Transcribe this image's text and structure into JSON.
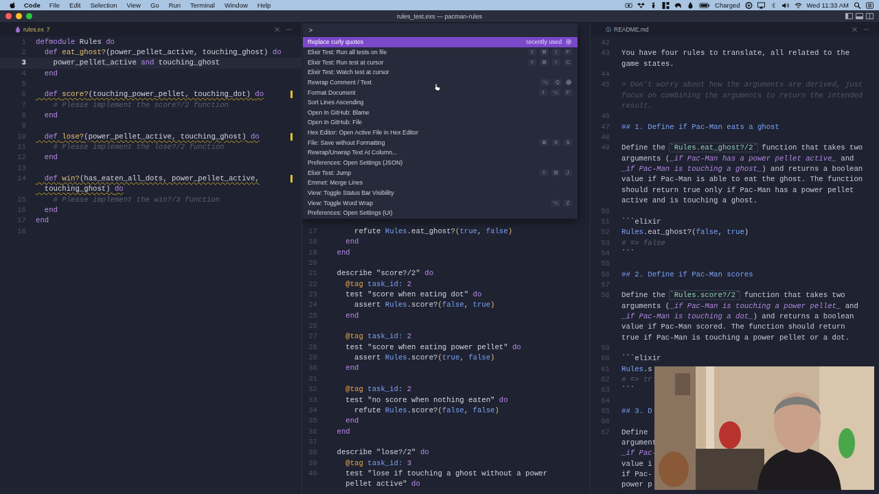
{
  "menu_bar": {
    "app": "Code",
    "menus": [
      "File",
      "Edit",
      "Selection",
      "View",
      "Go",
      "Run",
      "Terminal",
      "Window",
      "Help"
    ],
    "battery": "Charged",
    "clock": "Wed 11:33 AM"
  },
  "window": {
    "title": "rules_test.exs — pacman-rules"
  },
  "left": {
    "tab": {
      "title": "rules.ex",
      "problems": "7"
    },
    "lines": [
      {
        "num": "1",
        "current": false,
        "warning": false,
        "spans": [
          {
            "text": "defmodule",
            "kind": "kw"
          },
          {
            "text": " Rules ",
            "kind": "plain"
          },
          {
            "text": "do",
            "kind": "kw"
          }
        ]
      },
      {
        "num": "2",
        "current": false,
        "warning": false,
        "spans": [
          {
            "text": "  def ",
            "kind": "kw"
          },
          {
            "text": "eat_ghost?",
            "kind": "fn"
          },
          {
            "text": "(power_pellet_active, touching_ghost) ",
            "kind": "plain"
          },
          {
            "text": "do",
            "kind": "kw"
          }
        ]
      },
      {
        "num": "3",
        "current": true,
        "warning": false,
        "spans": [
          {
            "text": "    power_pellet_active ",
            "kind": "plain"
          },
          {
            "text": "and",
            "kind": "kw"
          },
          {
            "text": " touching_ghost",
            "kind": "plain"
          }
        ]
      },
      {
        "num": "4",
        "current": false,
        "warning": false,
        "spans": [
          {
            "text": "  end",
            "kind": "kw"
          }
        ]
      },
      {
        "num": "5",
        "current": false,
        "warning": false
      },
      {
        "num": "6",
        "current": false,
        "warning": true,
        "spans": [
          {
            "text": "  def ",
            "kind": "kw"
          },
          {
            "text": "score?",
            "kind": "fn"
          },
          {
            "text": "(touching_power_pellet, touching_dot) ",
            "kind": "plain"
          },
          {
            "text": "do",
            "kind": "kw"
          }
        ]
      },
      {
        "num": "7",
        "current": false,
        "warning": false,
        "spans": [
          {
            "text": "    # Please implement the score?/2 function",
            "kind": "comment"
          }
        ]
      },
      {
        "num": "8",
        "current": false,
        "warning": false,
        "spans": [
          {
            "text": "  end",
            "kind": "kw"
          }
        ]
      },
      {
        "num": "9",
        "current": false,
        "warning": false
      },
      {
        "num": "10",
        "current": false,
        "warning": true,
        "spans": [
          {
            "text": "  def ",
            "kind": "kw"
          },
          {
            "text": "lose?",
            "kind": "fn"
          },
          {
            "text": "(power_pellet_active, touching_ghost) ",
            "kind": "plain"
          },
          {
            "text": "do",
            "kind": "kw"
          }
        ]
      },
      {
        "num": "11",
        "current": false,
        "warning": false,
        "spans": [
          {
            "text": "    # Please implement the lose?/2 function",
            "kind": "comment"
          }
        ]
      },
      {
        "num": "12",
        "current": false,
        "warning": false,
        "spans": [
          {
            "text": "  end",
            "kind": "kw"
          }
        ]
      },
      {
        "num": "13",
        "current": false,
        "warning": false
      },
      {
        "num": "14",
        "current": false,
        "warning": true,
        "spans": [
          {
            "text": "  def ",
            "kind": "kw"
          },
          {
            "text": "win?",
            "kind": "fn"
          },
          {
            "text": "(has_eaten_all_dots, power_pellet_active,",
            "kind": "plain"
          }
        ]
      },
      {
        "current": false,
        "warning": true,
        "spans": [
          {
            "text": "  touching_ghost) ",
            "kind": "plain"
          },
          {
            "text": "do",
            "kind": "kw"
          }
        ]
      },
      {
        "num": "15",
        "current": false,
        "warning": false,
        "spans": [
          {
            "text": "    # Please implement the win?/3 function",
            "kind": "comment"
          }
        ]
      },
      {
        "num": "16",
        "current": false,
        "warning": false,
        "spans": [
          {
            "text": "  end",
            "kind": "kw"
          }
        ]
      },
      {
        "num": "17",
        "current": false,
        "warning": false,
        "spans": [
          {
            "text": "end",
            "kind": "kw"
          }
        ]
      },
      {
        "num": "18",
        "current": false,
        "warning": false
      }
    ]
  },
  "palette": {
    "input": ">",
    "items": [
      {
        "label": "Replace curly quotes",
        "selected": true,
        "hovered": false,
        "note": "recently used"
      },
      {
        "label": "Elixir Test: Run all tests on file",
        "selected": false,
        "hovered": false,
        "keys": [
          "⇧",
          "⌘",
          "I",
          "F"
        ]
      },
      {
        "label": "Elixir Test: Run test at cursor",
        "selected": false,
        "hovered": false,
        "keys": [
          "⇧",
          "⌘",
          "I",
          "C"
        ]
      },
      {
        "label": "Elixir Test: Watch test at cursor",
        "selected": false,
        "hovered": false
      },
      {
        "label": "Rewrap Comment / Text",
        "selected": false,
        "hovered": true,
        "keys": [
          "⌥",
          "Q"
        ]
      },
      {
        "label": "Format Document",
        "selected": false,
        "hovered": false,
        "keys": [
          "⇧",
          "⌥",
          "F"
        ]
      },
      {
        "label": "Sort Lines Ascending",
        "selected": false,
        "hovered": false
      },
      {
        "label": "Open In GitHub: Blame",
        "selected": false,
        "hovered": false
      },
      {
        "label": "Open In GitHub: File",
        "selected": false,
        "hovered": false
      },
      {
        "label": "Hex Editor: Open Active File in Hex Editor",
        "selected": false,
        "hovered": false
      },
      {
        "label": "File: Save without Formatting",
        "selected": false,
        "hovered": false,
        "keys": [
          "⌘",
          "K",
          "S"
        ]
      },
      {
        "label": "Rewrap/Unwrap Text At Column...",
        "selected": false,
        "hovered": false
      },
      {
        "label": "Preferences: Open Settings (JSON)",
        "selected": false,
        "hovered": false
      },
      {
        "label": "Elixir Test: Jump",
        "selected": false,
        "hovered": false,
        "keys": [
          "⇧",
          "⌘",
          "J"
        ]
      },
      {
        "label": "Emmet: Merge Lines",
        "selected": false,
        "hovered": false
      },
      {
        "label": "View: Toggle Status Bar Visibility",
        "selected": false,
        "hovered": false
      },
      {
        "label": "View: Toggle Word Wrap",
        "selected": false,
        "hovered": false,
        "keys": [
          "⌥",
          "Z"
        ]
      },
      {
        "label": "Preferences: Open Settings (UI)",
        "selected": false,
        "hovered": false
      }
    ]
  },
  "middle": {
    "lines": [
      {
        "num": "17",
        "spans": [
          {
            "text": "        refute ",
            "kind": "plain"
          },
          {
            "text": "Rules",
            "kind": "mod"
          },
          {
            "text": ".eat_ghost?",
            "kind": "plain"
          },
          {
            "text": "(",
            "kind": "paren"
          },
          {
            "text": "true",
            "kind": "bool"
          },
          {
            "text": ", ",
            "kind": "plain"
          },
          {
            "text": "false",
            "kind": "bool"
          },
          {
            "text": ")",
            "kind": "paren"
          }
        ]
      },
      {
        "num": "18",
        "spans": [
          {
            "text": "      end",
            "kind": "kw"
          }
        ]
      },
      {
        "num": "19",
        "spans": [
          {
            "text": "    end",
            "kind": "kw"
          }
        ]
      },
      {
        "num": "20"
      },
      {
        "num": "21",
        "spans": [
          {
            "text": "    describe \"score?/2\" ",
            "kind": "plain"
          },
          {
            "text": "do",
            "kind": "kw"
          }
        ]
      },
      {
        "num": "22",
        "spans": [
          {
            "text": "      @tag ",
            "kind": "attr"
          },
          {
            "text": "task_id: ",
            "kind": "atom"
          },
          {
            "text": "2",
            "kind": "num"
          }
        ]
      },
      {
        "num": "23",
        "spans": [
          {
            "text": "      test \"score when eating dot\" ",
            "kind": "plain"
          },
          {
            "text": "do",
            "kind": "kw"
          }
        ]
      },
      {
        "num": "24",
        "spans": [
          {
            "text": "        assert ",
            "kind": "plain"
          },
          {
            "text": "Rules",
            "kind": "mod"
          },
          {
            "text": ".score?",
            "kind": "plain"
          },
          {
            "text": "(",
            "kind": "paren"
          },
          {
            "text": "false",
            "kind": "bool"
          },
          {
            "text": ", ",
            "kind": "plain"
          },
          {
            "text": "true",
            "kind": "bool"
          },
          {
            "text": ")",
            "kind": "paren"
          }
        ]
      },
      {
        "num": "25",
        "spans": [
          {
            "text": "      end",
            "kind": "kw"
          }
        ]
      },
      {
        "num": "26"
      },
      {
        "num": "27",
        "spans": [
          {
            "text": "      @tag ",
            "kind": "attr"
          },
          {
            "text": "task_id: ",
            "kind": "atom"
          },
          {
            "text": "2",
            "kind": "num"
          }
        ]
      },
      {
        "num": "28",
        "spans": [
          {
            "text": "      test \"score when eating power pellet\" ",
            "kind": "plain"
          },
          {
            "text": "do",
            "kind": "kw"
          }
        ]
      },
      {
        "num": "29",
        "spans": [
          {
            "text": "        assert ",
            "kind": "plain"
          },
          {
            "text": "Rules",
            "kind": "mod"
          },
          {
            "text": ".score?",
            "kind": "plain"
          },
          {
            "text": "(",
            "kind": "paren"
          },
          {
            "text": "true",
            "kind": "bool"
          },
          {
            "text": ", ",
            "kind": "plain"
          },
          {
            "text": "false",
            "kind": "bool"
          },
          {
            "text": ")",
            "kind": "paren"
          }
        ]
      },
      {
        "num": "30",
        "spans": [
          {
            "text": "      end",
            "kind": "kw"
          }
        ]
      },
      {
        "num": "31"
      },
      {
        "num": "32",
        "spans": [
          {
            "text": "      @tag ",
            "kind": "attr"
          },
          {
            "text": "task_id: ",
            "kind": "atom"
          },
          {
            "text": "2",
            "kind": "num"
          }
        ]
      },
      {
        "num": "33",
        "spans": [
          {
            "text": "      test \"no score when nothing eaten\" ",
            "kind": "plain"
          },
          {
            "text": "do",
            "kind": "kw"
          }
        ]
      },
      {
        "num": "34",
        "spans": [
          {
            "text": "        refute ",
            "kind": "plain"
          },
          {
            "text": "Rules",
            "kind": "mod"
          },
          {
            "text": ".score?",
            "kind": "plain"
          },
          {
            "text": "(",
            "kind": "paren"
          },
          {
            "text": "false",
            "kind": "bool"
          },
          {
            "text": ", ",
            "kind": "plain"
          },
          {
            "text": "false",
            "kind": "bool"
          },
          {
            "text": ")",
            "kind": "paren"
          }
        ]
      },
      {
        "num": "35",
        "spans": [
          {
            "text": "      end",
            "kind": "kw"
          }
        ]
      },
      {
        "num": "36",
        "spans": [
          {
            "text": "    end",
            "kind": "kw"
          }
        ]
      },
      {
        "num": "37"
      },
      {
        "num": "38",
        "spans": [
          {
            "text": "    describe \"lose?/2\" ",
            "kind": "plain"
          },
          {
            "text": "do",
            "kind": "kw"
          }
        ]
      },
      {
        "num": "39",
        "spans": [
          {
            "text": "      @tag ",
            "kind": "attr"
          },
          {
            "text": "task_id: ",
            "kind": "atom"
          },
          {
            "text": "3",
            "kind": "num"
          }
        ]
      },
      {
        "num": "40",
        "spans": [
          {
            "text": "      test \"lose if touching a ghost without a power",
            "kind": "plain"
          }
        ]
      },
      {
        "spans": [
          {
            "text": "      pellet active\" ",
            "kind": "plain"
          },
          {
            "text": "do",
            "kind": "kw"
          }
        ]
      }
    ]
  },
  "right": {
    "tab": {
      "title": "README.md"
    },
    "lines": [
      {
        "num": "42"
      },
      {
        "num": "43",
        "spans": [
          {
            "text": "You have four rules to translate, all related to the",
            "kind": "text"
          }
        ]
      },
      {
        "spans": [
          {
            "text": "game states.",
            "kind": "text"
          }
        ]
      },
      {
        "num": "44"
      },
      {
        "num": "45",
        "spans": [
          {
            "text": "> Don't worry about how the arguments are derived, just",
            "kind": "quote"
          }
        ]
      },
      {
        "spans": [
          {
            "text": "focus on combining the arguments to return the intended",
            "kind": "quote"
          }
        ]
      },
      {
        "spans": [
          {
            "text": "result.",
            "kind": "quote"
          }
        ]
      },
      {
        "num": "46"
      },
      {
        "num": "47",
        "spans": [
          {
            "text": "## 1. Define if Pac-Man eats a ghost",
            "kind": "heading"
          }
        ]
      },
      {
        "num": "48"
      },
      {
        "num": "49",
        "spans": [
          {
            "text": "Define the ",
            "kind": "text"
          },
          {
            "text": "`Rules.eat_ghost?/2`",
            "kind": "code"
          },
          {
            "text": " function that takes two",
            "kind": "text"
          }
        ]
      },
      {
        "spans": [
          {
            "text": "arguments (",
            "kind": "text"
          },
          {
            "text": "_if Pac-Man has a power pellet active_",
            "kind": "em"
          },
          {
            "text": " and",
            "kind": "text"
          }
        ]
      },
      {
        "spans": [
          {
            "text": "_if Pac-Man is touching a ghost_",
            "kind": "em"
          },
          {
            "text": ") and returns a boolean",
            "kind": "text"
          }
        ]
      },
      {
        "spans": [
          {
            "text": "value if Pac-Man is able to eat the ghost. The function",
            "kind": "text"
          }
        ]
      },
      {
        "spans": [
          {
            "text": "should return true only if Pac-Man has a power pellet",
            "kind": "text"
          }
        ]
      },
      {
        "spans": [
          {
            "text": "active and is touching a ghost.",
            "kind": "text"
          }
        ]
      },
      {
        "num": "50"
      },
      {
        "num": "51",
        "spans": [
          {
            "text": "```elixir",
            "kind": "text"
          }
        ]
      },
      {
        "num": "52",
        "spans": [
          {
            "text": "Rules",
            "kind": "mod"
          },
          {
            "text": ".eat_ghost?(",
            "kind": "text"
          },
          {
            "text": "false",
            "kind": "bool"
          },
          {
            "text": ", ",
            "kind": "text"
          },
          {
            "text": "true",
            "kind": "bool"
          },
          {
            "text": ")",
            "kind": "text"
          }
        ]
      },
      {
        "num": "53",
        "spans": [
          {
            "text": "# => false",
            "kind": "comment"
          }
        ]
      },
      {
        "num": "54",
        "spans": [
          {
            "text": "```",
            "kind": "text"
          }
        ]
      },
      {
        "num": "55"
      },
      {
        "num": "56",
        "spans": [
          {
            "text": "## 2. Define if Pac-Man scores",
            "kind": "heading"
          }
        ]
      },
      {
        "num": "57"
      },
      {
        "num": "58",
        "spans": [
          {
            "text": "Define the ",
            "kind": "text"
          },
          {
            "text": "`Rules.score?/2`",
            "kind": "code"
          },
          {
            "text": " function that takes two",
            "kind": "text"
          }
        ]
      },
      {
        "spans": [
          {
            "text": "arguments (",
            "kind": "text"
          },
          {
            "text": "_if Pac-Man is touching a power pellet_",
            "kind": "em"
          },
          {
            "text": " and",
            "kind": "text"
          }
        ]
      },
      {
        "spans": [
          {
            "text": "_if Pac-Man is touching a dot_",
            "kind": "em"
          },
          {
            "text": ") and returns a boolean",
            "kind": "text"
          }
        ]
      },
      {
        "spans": [
          {
            "text": "value if Pac-Man scored. The function should return",
            "kind": "text"
          }
        ]
      },
      {
        "spans": [
          {
            "text": "true if Pac-Man is touching a power pellet or a dot.",
            "kind": "text"
          }
        ]
      },
      {
        "num": "59"
      },
      {
        "num": "60",
        "spans": [
          {
            "text": "```elixir",
            "kind": "text"
          }
        ]
      },
      {
        "num": "61",
        "spans": [
          {
            "text": "Rules",
            "kind": "mod"
          },
          {
            "text": ".s",
            "kind": "text"
          }
        ]
      },
      {
        "num": "62",
        "spans": [
          {
            "text": "# => tr",
            "kind": "comment"
          }
        ]
      },
      {
        "num": "63",
        "spans": [
          {
            "text": "```",
            "kind": "text"
          }
        ]
      },
      {
        "num": "64"
      },
      {
        "num": "65",
        "spans": [
          {
            "text": "## 3. D",
            "kind": "heading"
          }
        ]
      },
      {
        "num": "66"
      },
      {
        "num": "67",
        "spans": [
          {
            "text": "Define",
            "kind": "text"
          }
        ]
      },
      {
        "spans": [
          {
            "text": "argument",
            "kind": "text"
          }
        ]
      },
      {
        "spans": [
          {
            "text": "_if Pac-",
            "kind": "em"
          }
        ]
      },
      {
        "spans": [
          {
            "text": "value i",
            "kind": "text"
          }
        ]
      },
      {
        "spans": [
          {
            "text": "if Pac-",
            "kind": "text"
          }
        ]
      },
      {
        "spans": [
          {
            "text": "power p",
            "kind": "text"
          }
        ]
      }
    ]
  }
}
